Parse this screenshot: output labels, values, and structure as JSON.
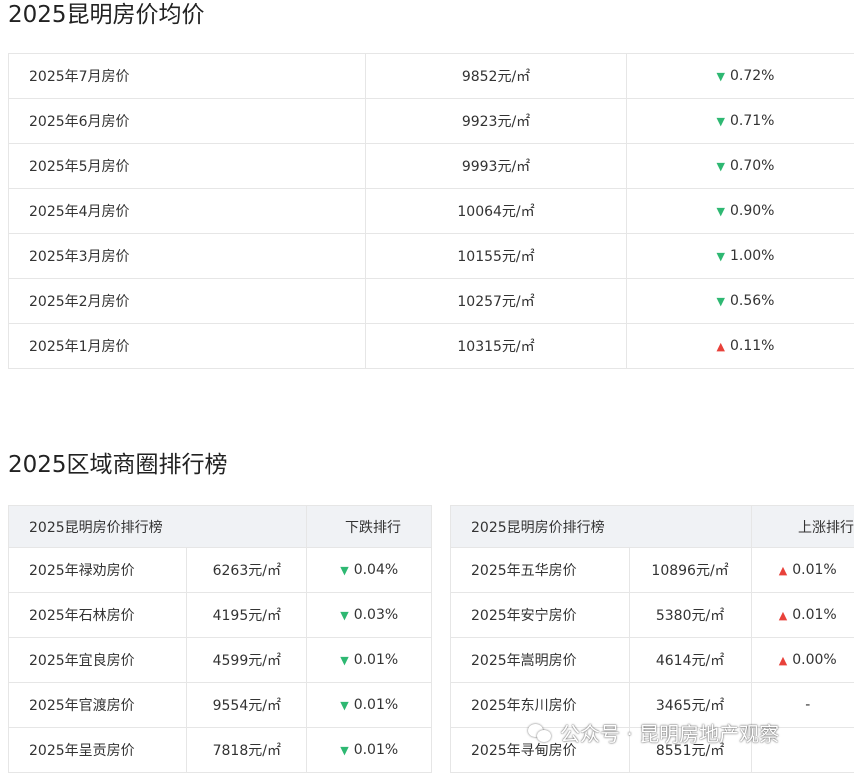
{
  "monthly": {
    "title": "2025昆明房价均价",
    "rows": [
      {
        "label": "2025年7月房价",
        "price": "9852元/㎡",
        "change": "0.72%",
        "trend": "down"
      },
      {
        "label": "2025年6月房价",
        "price": "9923元/㎡",
        "change": "0.71%",
        "trend": "down"
      },
      {
        "label": "2025年5月房价",
        "price": "9993元/㎡",
        "change": "0.70%",
        "trend": "down"
      },
      {
        "label": "2025年4月房价",
        "price": "10064元/㎡",
        "change": "0.90%",
        "trend": "down"
      },
      {
        "label": "2025年3月房价",
        "price": "10155元/㎡",
        "change": "1.00%",
        "trend": "down"
      },
      {
        "label": "2025年2月房价",
        "price": "10257元/㎡",
        "change": "0.56%",
        "trend": "down"
      },
      {
        "label": "2025年1月房价",
        "price": "10315元/㎡",
        "change": "0.11%",
        "trend": "up"
      }
    ]
  },
  "ranking": {
    "title": "2025区域商圈排行榜",
    "left": {
      "header_title": "2025昆明房价排行榜",
      "header_type": "下跌排行",
      "rows": [
        {
          "label": "2025年禄劝房价",
          "price": "6263元/㎡",
          "change": "0.04%",
          "trend": "down"
        },
        {
          "label": "2025年石林房价",
          "price": "4195元/㎡",
          "change": "0.03%",
          "trend": "down"
        },
        {
          "label": "2025年宜良房价",
          "price": "4599元/㎡",
          "change": "0.01%",
          "trend": "down"
        },
        {
          "label": "2025年官渡房价",
          "price": "9554元/㎡",
          "change": "0.01%",
          "trend": "down"
        },
        {
          "label": "2025年呈贡房价",
          "price": "7818元/㎡",
          "change": "0.01%",
          "trend": "down"
        }
      ]
    },
    "right": {
      "header_title": "2025昆明房价排行榜",
      "header_type": "上涨排行",
      "rows": [
        {
          "label": "2025年五华房价",
          "price": "10896元/㎡",
          "change": "0.01%",
          "trend": "up"
        },
        {
          "label": "2025年安宁房价",
          "price": "5380元/㎡",
          "change": "0.01%",
          "trend": "up"
        },
        {
          "label": "2025年嵩明房价",
          "price": "4614元/㎡",
          "change": "0.00%",
          "trend": "up"
        },
        {
          "label": "2025年东川房价",
          "price": "3465元/㎡",
          "change": "-",
          "trend": "none"
        },
        {
          "label": "2025年寻甸房价",
          "price": "8551元/㎡",
          "change": "",
          "trend": "none"
        }
      ]
    }
  },
  "watermark": {
    "text": "公众号 · 昆明房地产观察",
    "icon": "wechat-icon"
  },
  "colors": {
    "down": "#2eb872",
    "up": "#e8413a",
    "header_bg": "#f0f2f5",
    "border": "#e6e6e6"
  }
}
